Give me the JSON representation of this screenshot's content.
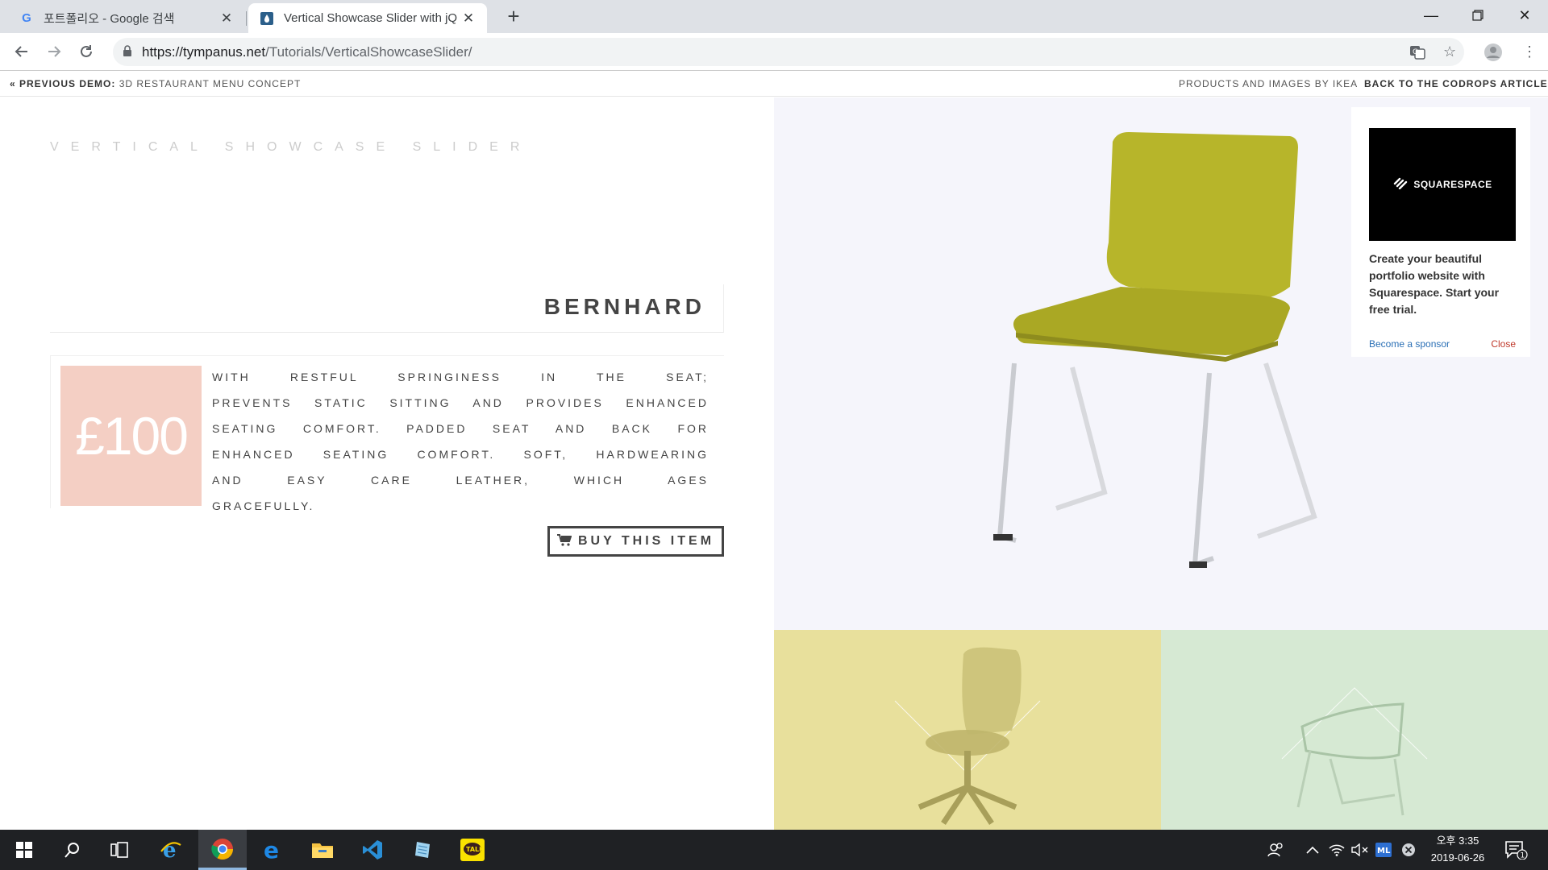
{
  "tabs": [
    {
      "title": "포트폴리오 - Google 검색",
      "favicon": "G"
    },
    {
      "title": "Vertical Showcase Slider with jQ",
      "favicon": "codrops-drop"
    }
  ],
  "address": {
    "host": "https://tympanus.net",
    "path": "/Tutorials/VerticalShowcaseSlider/"
  },
  "topbar": {
    "prev_label": "« PREVIOUS DEMO:",
    "prev_title": "3D RESTAURANT MENU CONCEPT",
    "products": "PRODUCTS AND IMAGES BY IKEA",
    "back": "BACK TO THE CODROPS ARTICLE"
  },
  "site_title": "VERTICAL SHOWCASE SLIDER",
  "product": {
    "name": "BERNHARD",
    "price": "£100",
    "description": "WITH RESTFUL SPRINGINESS IN THE SEAT; PREVENTS STATIC SITTING AND PROVIDES ENHANCED SEATING COMFORT. PADDED SEAT AND BACK FOR ENHANCED SEATING COMFORT. SOFT, HARDWEARING AND EASY CARE LEATHER, WHICH AGES GRACEFULLY.",
    "buy_label": "BUY THIS ITEM"
  },
  "colors": {
    "hero_bg": "#f5f5fb",
    "price_bg": "#f4cfc4",
    "thumb1_bg": "#e8e09c",
    "thumb2_bg": "#d6e9d3",
    "chair_seat": "#b7b52a"
  },
  "sponsor": {
    "brand": "SQUARESPACE",
    "text": "Create your beautiful portfolio website with Squarespace. Start your free trial.",
    "become": "Become a sponsor",
    "close": "Close"
  },
  "taskbar": {
    "time": "오후 3:35",
    "date": "2019-06-26",
    "notifications": "1",
    "apps": [
      "start-icon",
      "search-icon",
      "task-view-icon",
      "ie-icon",
      "chrome-icon",
      "edge-icon",
      "file-explorer-icon",
      "vscode-icon",
      "notepad-icon",
      "kakaotalk-icon"
    ]
  }
}
